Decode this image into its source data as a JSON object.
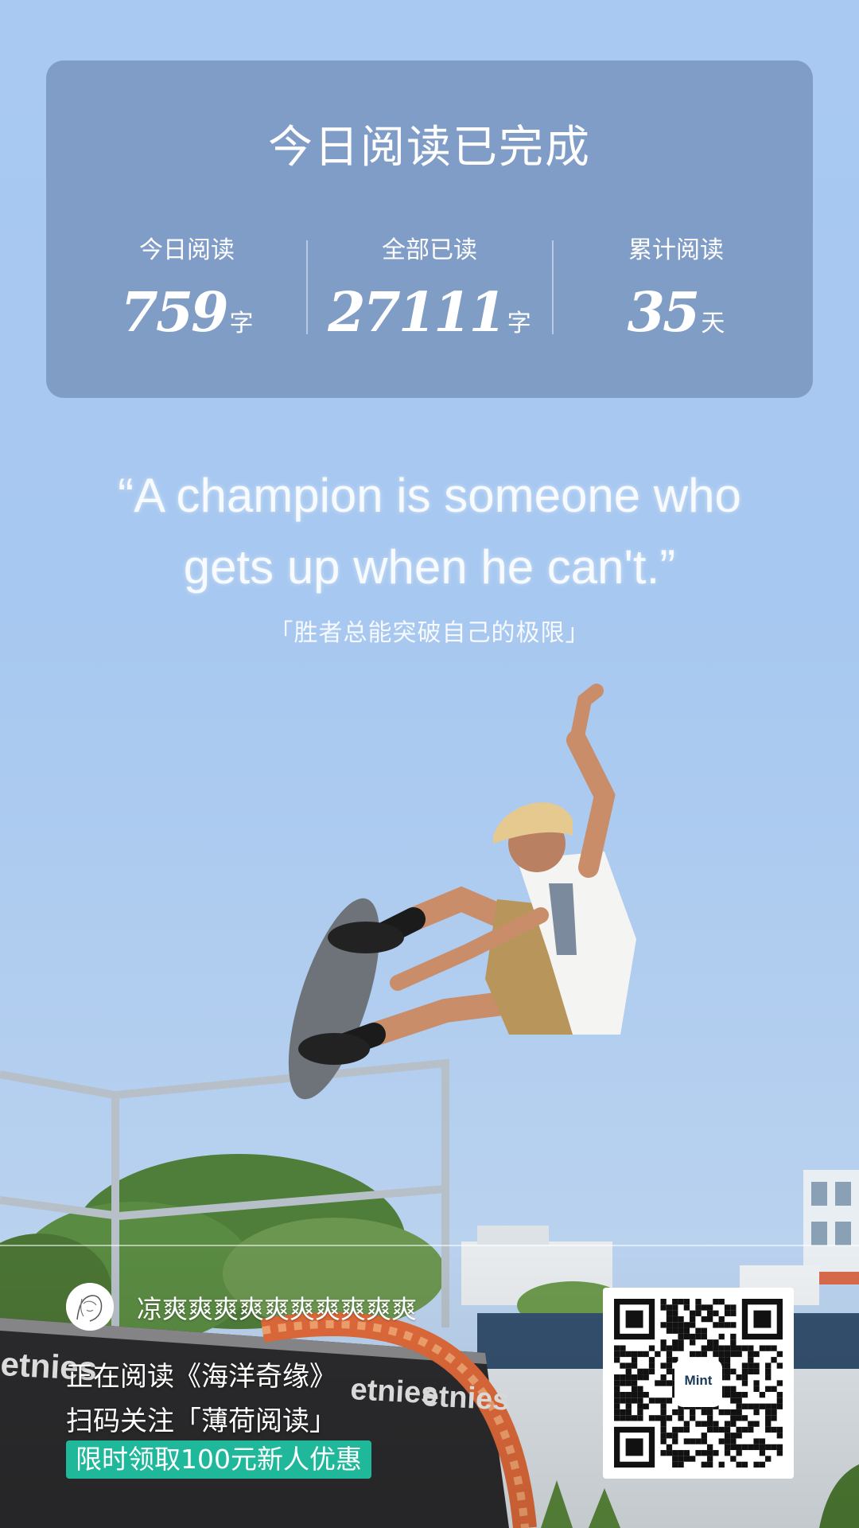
{
  "card": {
    "title": "今日阅读已完成",
    "stats": [
      {
        "label": "今日阅读",
        "value": "759",
        "unit": "字"
      },
      {
        "label": "全部已读",
        "value": "27111",
        "unit": "字"
      },
      {
        "label": "累计阅读",
        "value": "35",
        "unit": "天"
      }
    ]
  },
  "quote": {
    "line1": "“A champion is someone who",
    "line2": "gets up when he can't.”",
    "cn": "「胜者总能突破自己的极限」"
  },
  "scene_text": {
    "banner_brand": "etnies"
  },
  "footer": {
    "username": "凉爽爽爽爽爽爽爽爽爽爽",
    "reading": "正在阅读《海洋奇缘》",
    "follow": "扫码关注「薄荷阅读」",
    "promo": "限时领取100元新人优惠",
    "qr_logo": "Mint"
  },
  "colors": {
    "sky": "#a9c9f3",
    "card": "#708cb6",
    "promo": "#1fb89a"
  },
  "icons": {
    "avatar": "sketch-portrait-avatar",
    "qr": "qr-code-icon"
  }
}
